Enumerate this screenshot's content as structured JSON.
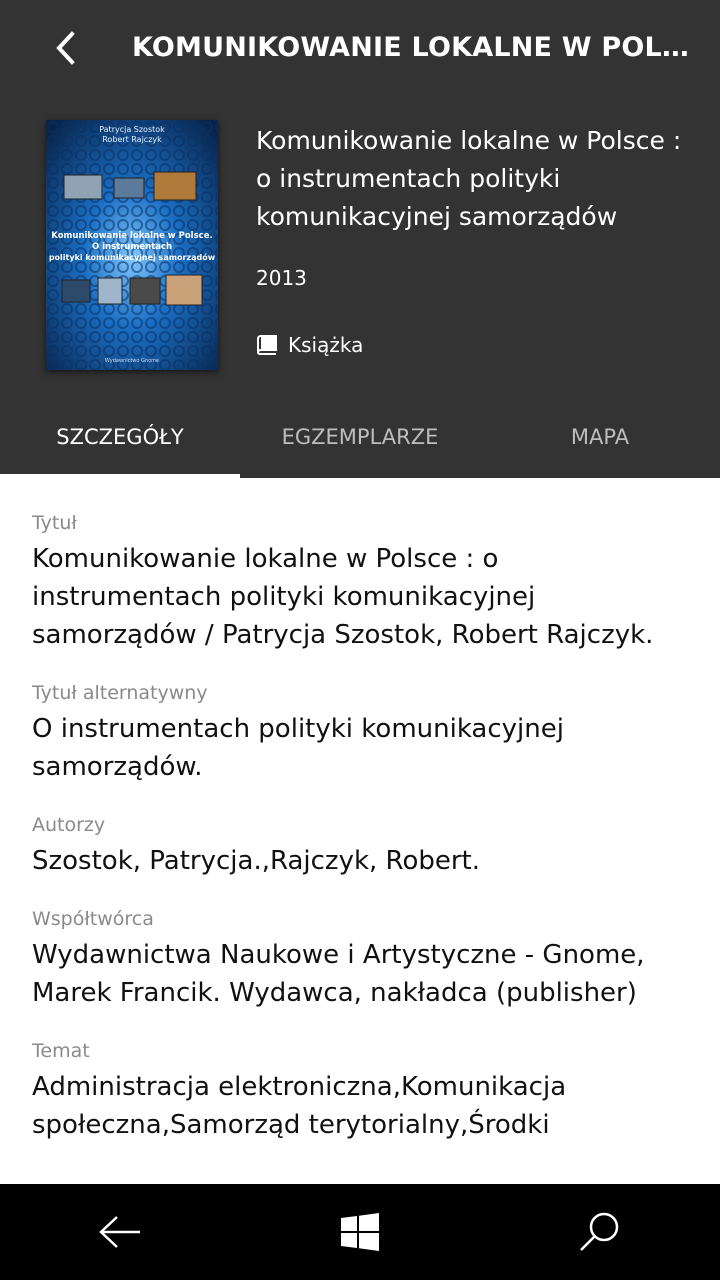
{
  "header": {
    "title": "KOMUNIKOWANIE LOKALNE W POLS...",
    "back_icon": "chevron-left-icon"
  },
  "book": {
    "cover": {
      "authors": "Patrycja Szostok\nRobert Rajczyk",
      "title_line1": "Komunikowanie lokalne w Polsce.",
      "title_line2": "O instrumentach",
      "title_line3": "polityki komunikacyjnej samorządów",
      "publisher": "Wydawnictwo Gnome"
    },
    "title": "Komunikowanie lokalne w Polsce : o instrumentach polityki komunikacyjnej samorządów",
    "year": "2013",
    "type": "Książka",
    "type_icon": "book-icon"
  },
  "tabs": [
    {
      "label": "SZCZEGÓŁY",
      "active": true
    },
    {
      "label": "EGZEMPLARZE",
      "active": false
    },
    {
      "label": "MAPA",
      "active": false
    }
  ],
  "details": [
    {
      "label": "Tytuł",
      "value": "Komunikowanie lokalne w Polsce : o instrumentach polityki komunikacyjnej samorządów / Patrycja Szostok, Robert Rajczyk."
    },
    {
      "label": "Tytuł alternatywny",
      "value": "O instrumentach polityki komunikacyjnej samorządów."
    },
    {
      "label": "Autorzy",
      "value": "Szostok, Patrycja.,Rajczyk, Robert."
    },
    {
      "label": "Współtwórca",
      "value": "Wydawnictwa Naukowe i Artystyczne - Gnome, Marek Francik. Wydawca, nakładca (publisher)"
    },
    {
      "label": "Temat",
      "value": "Administracja elektroniczna,Komunikacja społeczna,Samorząd terytorialny,Środki"
    }
  ],
  "bottom_nav": {
    "back_icon": "arrow-left-icon",
    "home_icon": "windows-logo-icon",
    "search_icon": "search-icon"
  },
  "colors": {
    "header_bg": "#333333",
    "bottom_bar_bg": "#000000",
    "cover_bg": "#1a5fa8"
  }
}
